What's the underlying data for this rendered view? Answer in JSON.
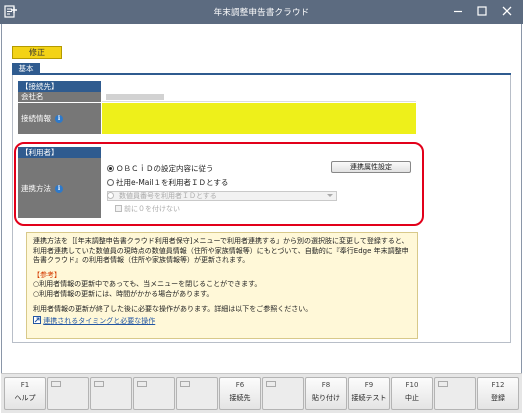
{
  "window": {
    "title": "年末調整申告書クラウド"
  },
  "toolbar": {
    "shusei_label": "修正"
  },
  "tabs": [
    {
      "label": "基本"
    }
  ],
  "connection": {
    "section_label": "【接続先】",
    "company_label": "会社名",
    "info_label": "接続情報"
  },
  "user_usage": {
    "section_label": "【利用者】",
    "method_label": "連携方法",
    "options": [
      "ＯＢＣｉＤの設定内容に従う",
      "社用e-Mail１を利用者ＩＤとする",
      "数値員番号を利用者ＩＤとする"
    ],
    "selected_option": 0,
    "checkbox_label": "前に０を付けない",
    "checkbox_checked": false,
    "settings_button": "連携属性設定"
  },
  "note": {
    "para1": "連携方法を［[年末調整申告書クラウド利用者保守]メニューで利用者連携する」から別の選択肢に変更して登録すると、利用者連携していた数値員の現時点の数値員情報（住所や家族情報等）にもとづいて、自動的に『奉行Edge 年末調整申告書クラウド』の利用者情報（住所や家族情報等）が更新されます。",
    "ref_title": "【参考】",
    "ref_items": [
      "○利用者情報の更新中であっても、当メニューを閉じることができます。",
      "○利用者情報の更新には、時間がかかる場合があります。"
    ],
    "para2": "利用者情報の更新が終了した後に必要な操作があります。詳細は以下をご参照ください。",
    "link": "連携されるタイミングと必要な操作"
  },
  "fkeys": [
    {
      "key": "F1",
      "label": "ヘルプ"
    },
    {
      "key": "",
      "label": ""
    },
    {
      "key": "",
      "label": ""
    },
    {
      "key": "",
      "label": ""
    },
    {
      "key": "",
      "label": ""
    },
    {
      "key": "F6",
      "label": "接続先"
    },
    {
      "key": "",
      "label": ""
    },
    {
      "key": "F8",
      "label": "貼り付け"
    },
    {
      "key": "F9",
      "label": "接続テスト"
    },
    {
      "key": "F10",
      "label": "中止"
    },
    {
      "key": "",
      "label": ""
    },
    {
      "key": "F12",
      "label": "登録"
    }
  ],
  "colors": {
    "titlebar": "#5c6b80",
    "accent": "#2f5b8f",
    "highlight_yellow": "#eef01a",
    "outline_red": "#e2001a",
    "note_bg": "#fff8d8"
  },
  "icons": [
    "app-icon",
    "minimize-icon",
    "maximize-icon",
    "close-icon",
    "info-icon",
    "link-icon"
  ]
}
